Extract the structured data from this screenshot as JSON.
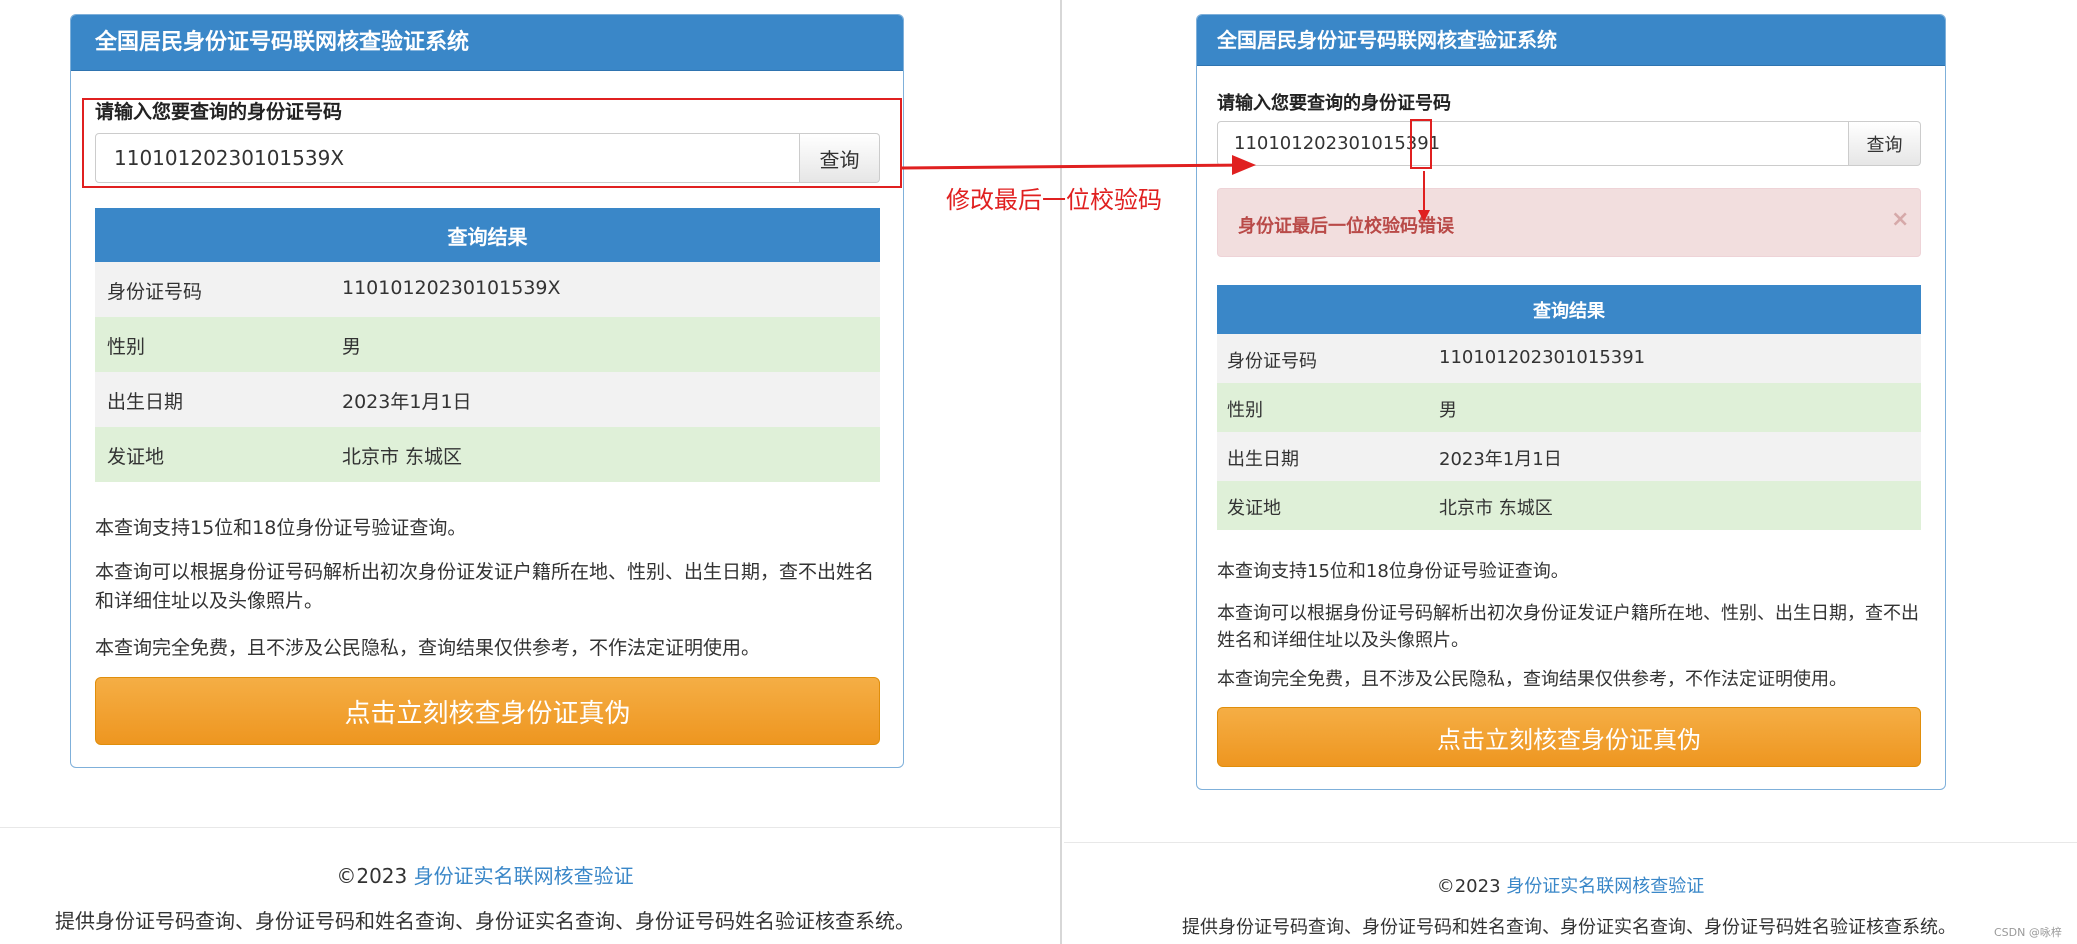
{
  "left": {
    "header_title": "全国居民身份证号码联网核查验证系统",
    "input_label": "请输入您要查询的身份证号码",
    "input_value": "11010120230101539X",
    "query_button": "查询",
    "result_title": "查询结果",
    "rows": [
      {
        "label": "身份证号码",
        "value": "11010120230101539X"
      },
      {
        "label": "性别",
        "value": "男"
      },
      {
        "label": "出生日期",
        "value": "2023年1月1日"
      },
      {
        "label": "发证地",
        "value": "北京市 东城区"
      }
    ],
    "notes": [
      "本查询支持15位和18位身份证号验证查询。",
      "本查询可以根据身份证号码解析出初次身份证发证户籍所在地、性别、出生日期，查不出姓名和详细住址以及头像照片。",
      "本查询完全免费，且不涉及公民隐私，查询结果仅供参考，不作法定证明使用。"
    ],
    "verify_button": "点击立刻核查身份证真伪",
    "footer_copyright": "©2023",
    "footer_link": "身份证实名联网核查验证",
    "footer_desc": "提供身份证号码查询、身份证号码和姓名查询、身份证实名查询、身份证号码姓名验证核查系统。"
  },
  "right": {
    "header_title": "全国居民身份证号码联网核查验证系统",
    "input_label": "请输入您要查询的身份证号码",
    "input_value": "110101202301015391",
    "query_button": "查询",
    "error_message": "身份证最后一位校验码错误",
    "close_symbol": "×",
    "result_title": "查询结果",
    "rows": [
      {
        "label": "身份证号码",
        "value": "110101202301015391"
      },
      {
        "label": "性别",
        "value": "男"
      },
      {
        "label": "出生日期",
        "value": "2023年1月1日"
      },
      {
        "label": "发证地",
        "value": "北京市 东城区"
      }
    ],
    "notes": [
      "本查询支持15位和18位身份证号验证查询。",
      "本查询可以根据身份证号码解析出初次身份证发证户籍所在地、性别、出生日期，查不出姓名和详细住址以及头像照片。",
      "本查询完全免费，且不涉及公民隐私，查询结果仅供参考，不作法定证明使用。"
    ],
    "verify_button": "点击立刻核查身份证真伪",
    "footer_copyright": "©2023",
    "footer_link": "身份证实名联网核查验证",
    "footer_desc": "提供身份证号码查询、身份证号码和姓名查询、身份证实名查询、身份证号码姓名验证核查系统。"
  },
  "annotation": {
    "text": "修改最后一位校验码",
    "color": "#e02020"
  },
  "watermark": "CSDN @咏梓",
  "colors": {
    "header_blue": "#3a87c8",
    "row_green": "#dff0d8",
    "row_gray": "#f2f2f2",
    "button_orange": "#f0a030",
    "error_bg": "#f2dede",
    "error_text": "#b94a48",
    "link_blue": "#3a87c8"
  }
}
